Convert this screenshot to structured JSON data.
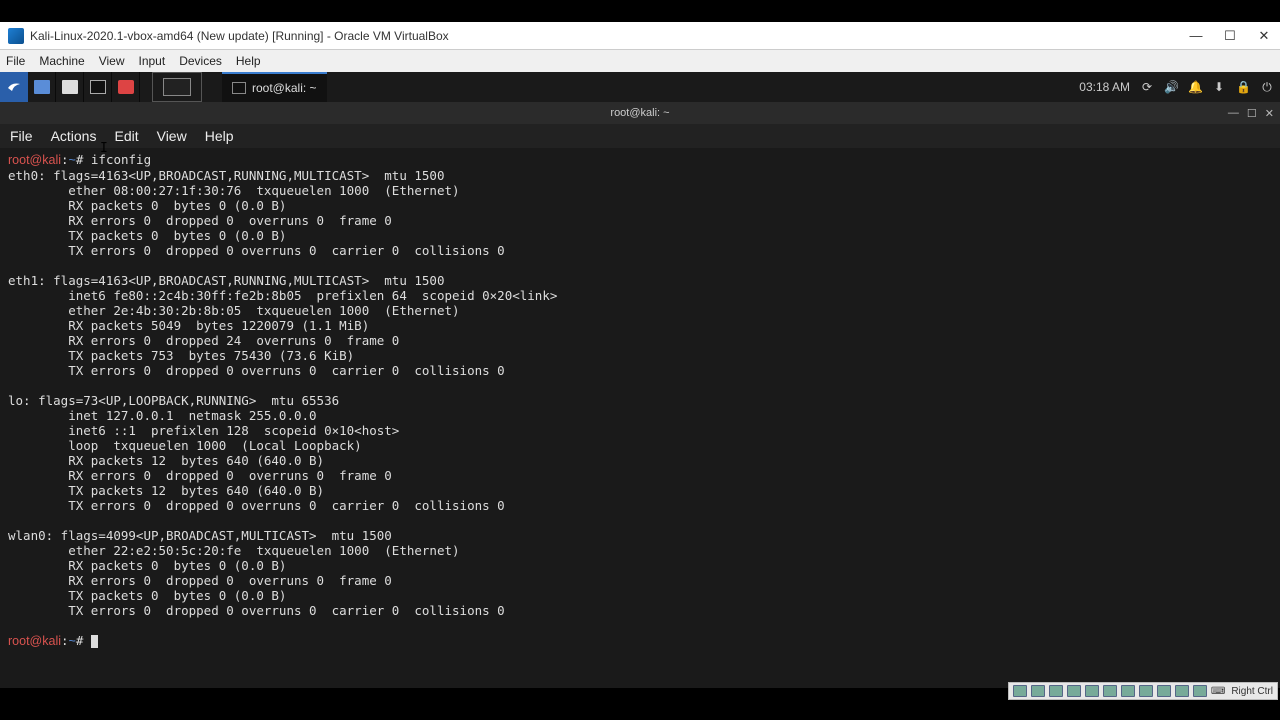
{
  "vbox": {
    "title": "Kali-Linux-2020.1-vbox-amd64 (New update) [Running] - Oracle VM VirtualBox",
    "menu": {
      "file": "File",
      "machine": "Machine",
      "view": "View",
      "input": "Input",
      "devices": "Devices",
      "help": "Help"
    },
    "statusbar_host": "Right Ctrl"
  },
  "kali_panel": {
    "clock": "03:18 AM",
    "task": "root@kali: ~"
  },
  "terminal": {
    "title": "root@kali: ~",
    "menu": {
      "file": "File",
      "actions": "Actions",
      "edit": "Edit",
      "view": "View",
      "help": "Help"
    },
    "prompt_user": "root",
    "prompt_host": "kali",
    "prompt_path": "~",
    "prompt_sep": "@",
    "prompt_mark": "#",
    "command": "ifconfig",
    "output_lines": [
      "eth0: flags=4163<UP,BROADCAST,RUNNING,MULTICAST>  mtu 1500",
      "        ether 08:00:27:1f:30:76  txqueuelen 1000  (Ethernet)",
      "        RX packets 0  bytes 0 (0.0 B)",
      "        RX errors 0  dropped 0  overruns 0  frame 0",
      "        TX packets 0  bytes 0 (0.0 B)",
      "        TX errors 0  dropped 0 overruns 0  carrier 0  collisions 0",
      "",
      "eth1: flags=4163<UP,BROADCAST,RUNNING,MULTICAST>  mtu 1500",
      "        inet6 fe80::2c4b:30ff:fe2b:8b05  prefixlen 64  scopeid 0×20<link>",
      "        ether 2e:4b:30:2b:8b:05  txqueuelen 1000  (Ethernet)",
      "        RX packets 5049  bytes 1220079 (1.1 MiB)",
      "        RX errors 0  dropped 24  overruns 0  frame 0",
      "        TX packets 753  bytes 75430 (73.6 KiB)",
      "        TX errors 0  dropped 0 overruns 0  carrier 0  collisions 0",
      "",
      "lo: flags=73<UP,LOOPBACK,RUNNING>  mtu 65536",
      "        inet 127.0.0.1  netmask 255.0.0.0",
      "        inet6 ::1  prefixlen 128  scopeid 0×10<host>",
      "        loop  txqueuelen 1000  (Local Loopback)",
      "        RX packets 12  bytes 640 (640.0 B)",
      "        RX errors 0  dropped 0  overruns 0  frame 0",
      "        TX packets 12  bytes 640 (640.0 B)",
      "        TX errors 0  dropped 0 overruns 0  carrier 0  collisions 0",
      "",
      "wlan0: flags=4099<UP,BROADCAST,MULTICAST>  mtu 1500",
      "        ether 22:e2:50:5c:20:fe  txqueuelen 1000  (Ethernet)",
      "        RX packets 0  bytes 0 (0.0 B)",
      "        RX errors 0  dropped 0  overruns 0  frame 0",
      "        TX packets 0  bytes 0 (0.0 B)",
      "        TX errors 0  dropped 0 overruns 0  carrier 0  collisions 0",
      ""
    ]
  }
}
